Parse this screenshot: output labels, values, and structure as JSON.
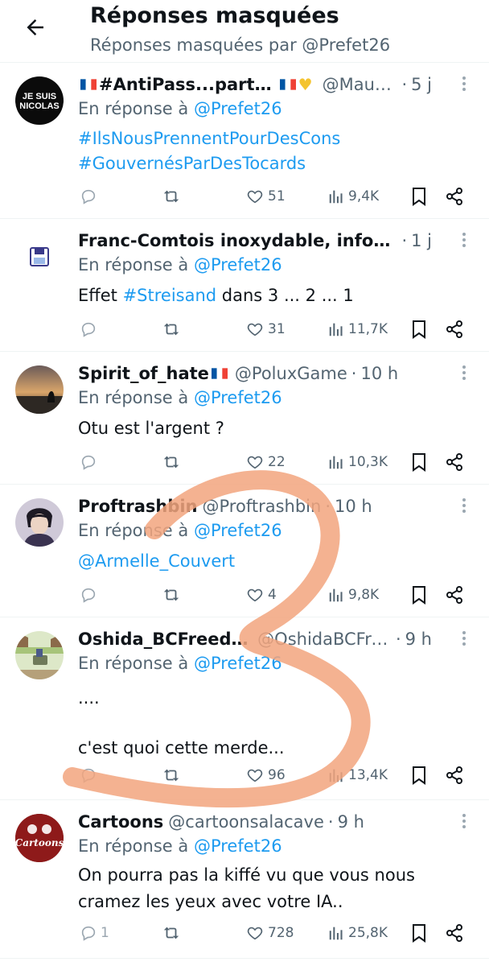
{
  "header": {
    "title": "Réponses masquées",
    "subtitle": "Réponses masquées par @Prefet26"
  },
  "reply_prefix": "En réponse à",
  "reply_target": "@Prefet26",
  "avatar_texts": {
    "t1": [
      "JE SUIS",
      "NICOLAS"
    ],
    "t6": "Cartoons"
  },
  "tweets": [
    {
      "name": "#AntiPass...partout",
      "handle": "@Maub...",
      "time": "5 j",
      "lines": [
        "#IlsNousPrennentPourDesCons",
        "#GouvernésParDesTocards"
      ],
      "replies": "",
      "likes": "51",
      "views": "9,4K"
    },
    {
      "name": "Franc-Comtois inoxydable, informa...",
      "handle": "",
      "time": "1 j",
      "text_before": "Effet ",
      "hashtag": "#Streisand",
      "text_after": " dans 3 ... 2 ... 1",
      "replies": "",
      "likes": "31",
      "views": "11,7K"
    },
    {
      "name": "Spirit_of_hate",
      "handle": "@PoluxGame",
      "time": "10 h",
      "text": "Otu est l'argent ?",
      "replies": "",
      "likes": "22",
      "views": "10,3K"
    },
    {
      "name": "Proftrashbin",
      "handle": "@Proftrashbin",
      "time": "10 h",
      "mention": "@Armelle_Couvert",
      "replies": "",
      "likes": "4",
      "views": "9,8K"
    },
    {
      "name": "Oshida_BCFreedom",
      "handle": "@OshidaBCFre...",
      "time": "9 h",
      "lines": [
        "....",
        "",
        "c'est quoi cette merde..."
      ],
      "replies": "",
      "likes": "96",
      "views": "13,4K"
    },
    {
      "name": "Cartoons",
      "handle": "@cartoonsalacave",
      "time": "9 h",
      "lines": [
        "On pourra pas la kiffé vu que vous nous",
        "cramez les yeux avec votre IA.."
      ],
      "replies": "1",
      "likes": "728",
      "views": "25,8K"
    }
  ],
  "colors": {
    "link": "#1d9bf0",
    "secondary_text": "#536471",
    "primary_text": "#0f1419",
    "scribble": "#f2a57e"
  },
  "icons": [
    "back-arrow-icon",
    "avatar",
    "more-icon",
    "reply-icon",
    "retweet-icon",
    "like-icon",
    "views-icon",
    "bookmark-icon",
    "share-icon",
    "french-flag-icon",
    "heart-hands-emoji"
  ]
}
